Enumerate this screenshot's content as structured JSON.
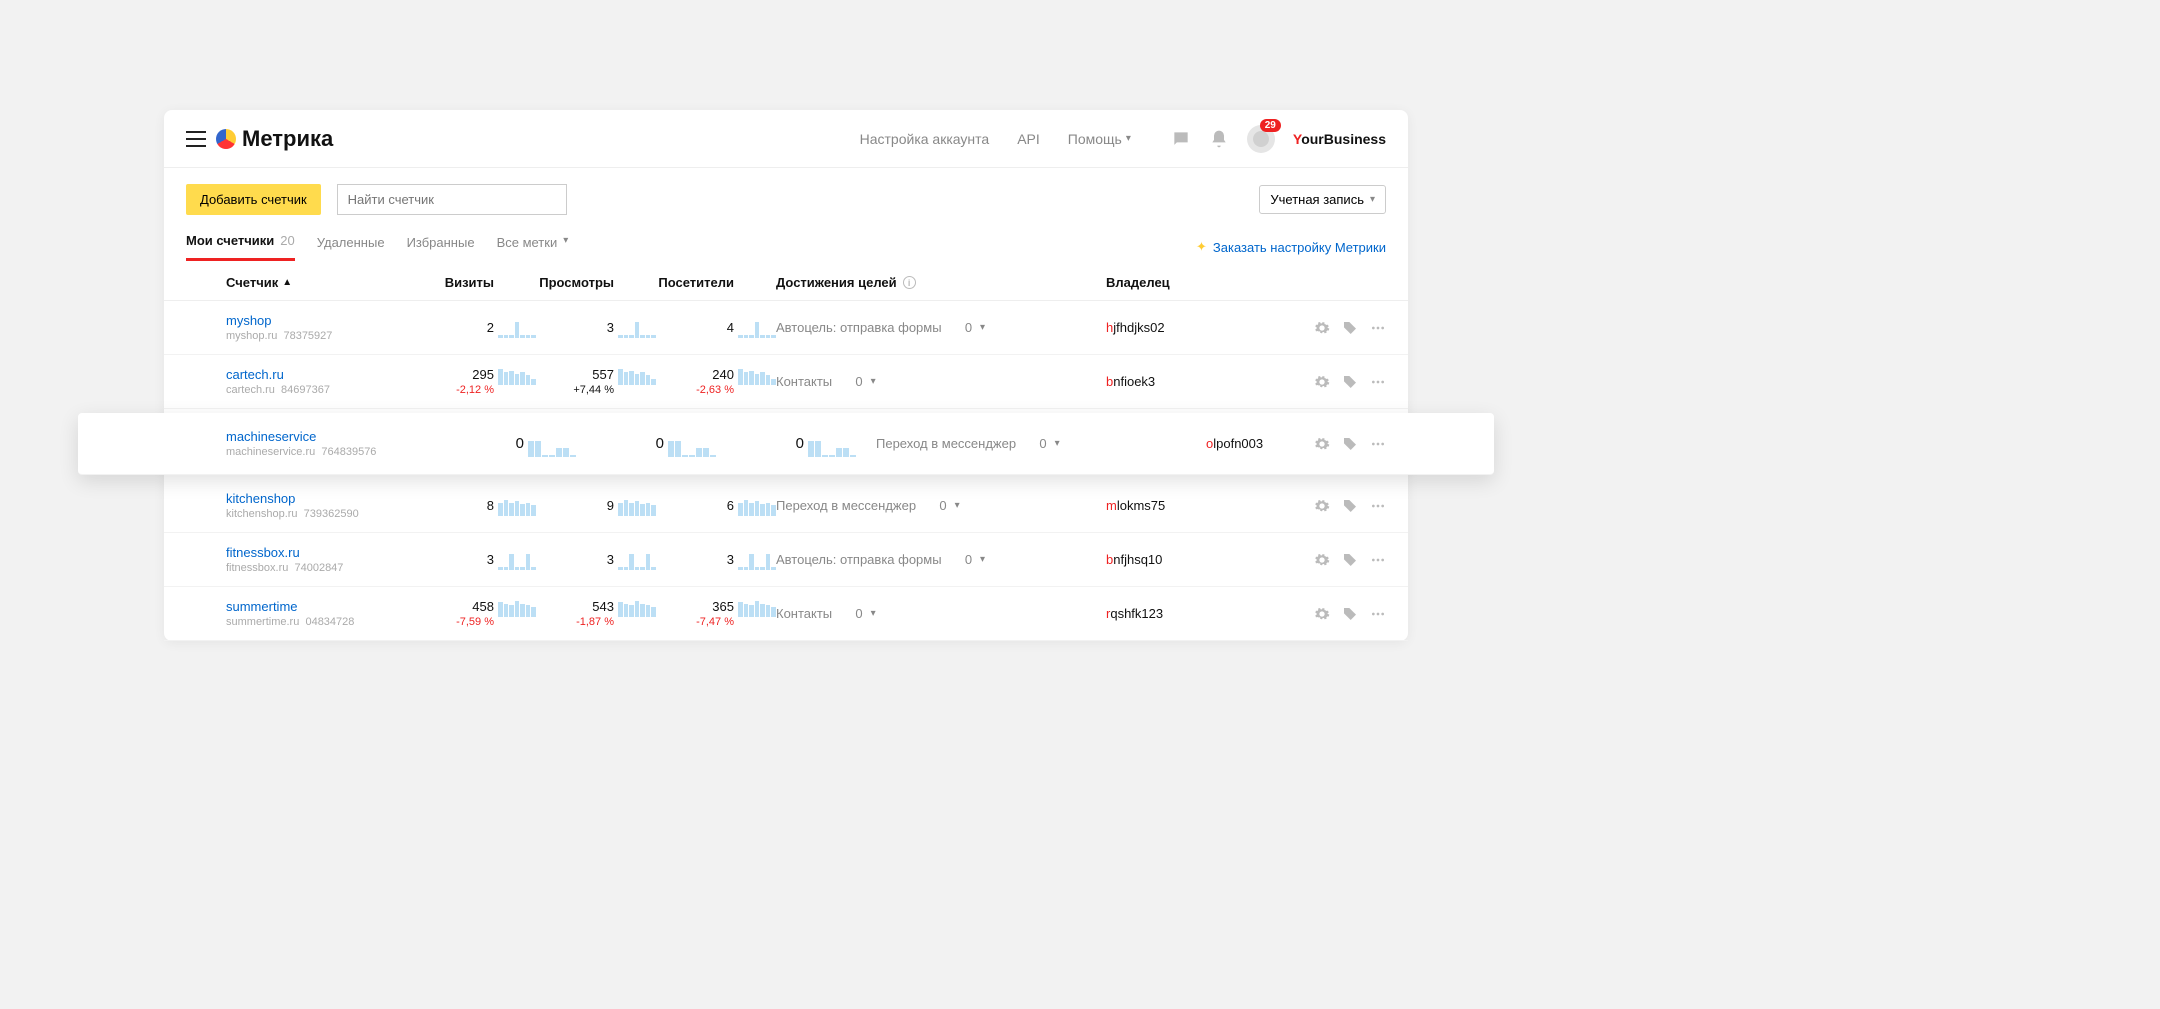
{
  "brand": "Метрика",
  "nav": {
    "settings": "Настройка аккаунта",
    "api": "API",
    "help": "Помощь"
  },
  "badge": "29",
  "user": "ourBusiness",
  "toolbar": {
    "add": "Добавить счетчик",
    "search_ph": "Найти счетчик",
    "account": "Учетная запись"
  },
  "tabs": {
    "my": "Мои счетчики",
    "my_count": "20",
    "deleted": "Удаленные",
    "fav": "Избранные",
    "labels": "Все метки"
  },
  "order": "Заказать настройку Метрики",
  "cols": {
    "counter": "Счетчик",
    "visits": "Визиты",
    "views": "Просмотры",
    "visitors": "Посетители",
    "goals": "Достижения целей",
    "owner": "Владелец"
  },
  "rows": [
    {
      "color": "#e74c3c",
      "name": "myshop",
      "domain": "myshop.ru",
      "id": "78375927",
      "visits": "2",
      "views": "3",
      "visitors": "4",
      "goal": "Автоцель: отправка формы",
      "goal_v": "0",
      "owner_h": "h",
      "owner_r": "jfhdjks02",
      "sp": [
        2,
        2,
        2,
        12,
        2,
        2,
        2
      ]
    },
    {
      "color": "#7b7b7b",
      "name": "cartech.ru",
      "domain": "cartech.ru",
      "id": "84697367",
      "visits": "295",
      "visits_d": "-2,12 %",
      "visits_dc": "neg",
      "views": "557",
      "views_d": "+7,44 %",
      "views_dc": "pos",
      "visitors": "240",
      "visitors_d": "-2,63 %",
      "visitors_dc": "neg",
      "goal": "Контакты",
      "goal_v": "0",
      "owner_h": "b",
      "owner_r": "nfioek3",
      "sp": [
        10,
        8,
        9,
        7,
        8,
        6,
        4
      ]
    },
    {
      "highlight": true,
      "color": "#3b5bdb",
      "name": "machineservice",
      "domain": "machineservice.ru",
      "id": "764839576",
      "visits": "0",
      "views": "0",
      "visitors": "0",
      "goal": "Переход в мессенджер",
      "goal_v": "0",
      "owner_h": "o",
      "owner_r": "lpofn003",
      "sp": [
        14,
        14,
        2,
        2,
        8,
        8,
        2
      ]
    },
    {
      "color": "#c9a98f",
      "name": "kitchenshop",
      "domain": "kitchenshop.ru",
      "id": "739362590",
      "visits": "8",
      "views": "9",
      "visitors": "6",
      "goal": "Переход в мессенджер",
      "goal_v": "0",
      "owner_h": "m",
      "owner_r": "lokms75",
      "sp": [
        10,
        12,
        10,
        11,
        9,
        10,
        8
      ]
    },
    {
      "color": "#8e2b8e",
      "name": "fitnessbox.ru",
      "domain": "fitnessbox.ru",
      "id": "74002847",
      "visits": "3",
      "views": "3",
      "visitors": "3",
      "goal": "Автоцель: отправка формы",
      "goal_v": "0",
      "owner_h": "b",
      "owner_r": "nfjhsq10",
      "sp": [
        2,
        2,
        10,
        2,
        2,
        10,
        2
      ]
    },
    {
      "color": "#6a7a57",
      "name": "summertime",
      "domain": "summertime.ru",
      "id": "04834728",
      "visits": "458",
      "visits_d": "-7,59 %",
      "visits_dc": "neg",
      "views": "543",
      "views_d": "-1,87 %",
      "views_dc": "neg",
      "visitors": "365",
      "visitors_d": "-7,47 %",
      "visitors_dc": "neg",
      "goal": "Контакты",
      "goal_v": "0",
      "owner_h": "r",
      "owner_r": "qshfk123",
      "sp": [
        10,
        9,
        8,
        11,
        9,
        8,
        7
      ]
    }
  ]
}
